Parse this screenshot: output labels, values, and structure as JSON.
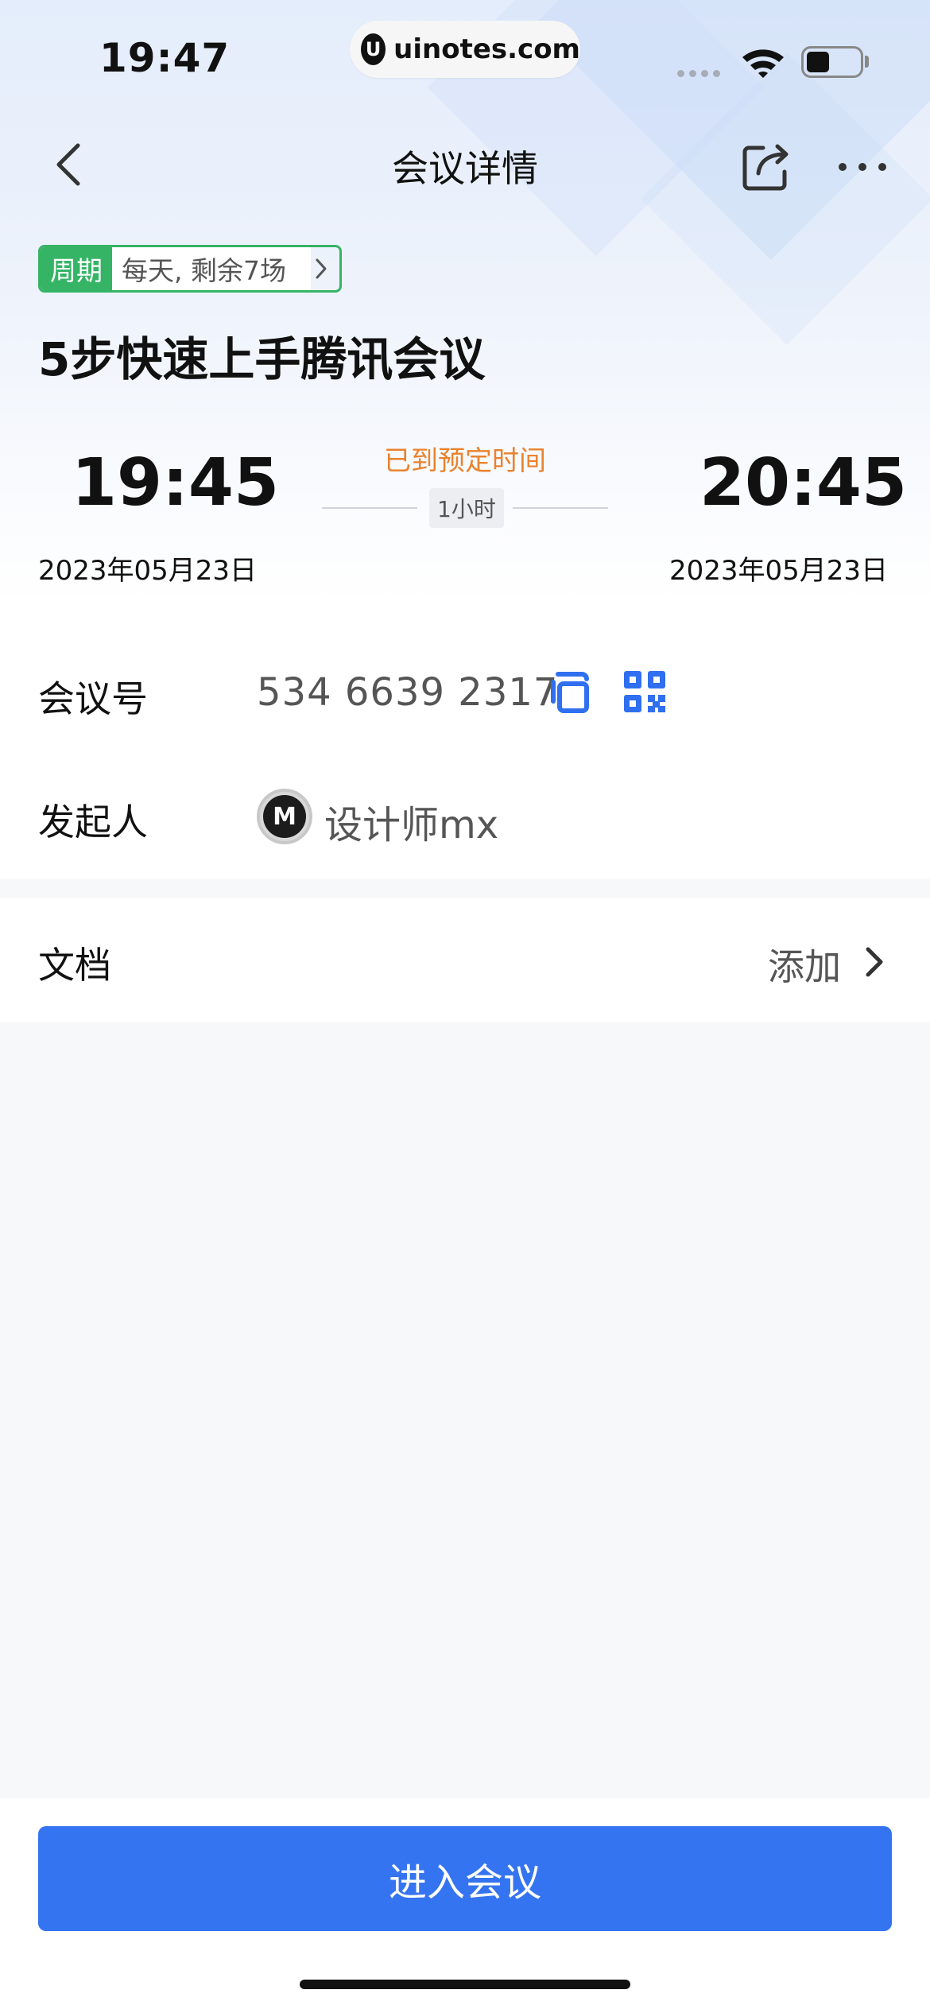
{
  "status_bar": {
    "time": "19:47",
    "url_logo": "U",
    "url": "uinotes.com",
    "icons": [
      "signal-icon",
      "wifi-icon",
      "battery-icon"
    ]
  },
  "nav": {
    "title": "会议详情",
    "icons": [
      "back-icon",
      "share-icon",
      "more-icon"
    ]
  },
  "meeting": {
    "tag_label": "周期",
    "tag_text": "每天, 剩余7场",
    "title": "5步快速上手腾讯会议",
    "start_time": "19:45",
    "end_time": "20:45",
    "start_date": "2023年05月23日",
    "end_date": "2023年05月23日",
    "status": "已到预定时间",
    "duration": "1小时"
  },
  "info": {
    "meeting_id_label": "会议号",
    "meeting_id": "534 6639 2317",
    "host_label": "发起人",
    "host_avatar_text": "M",
    "host_name": "设计师mx"
  },
  "docs": {
    "label": "文档",
    "add_label": "添加"
  },
  "footer": {
    "enter_button": "进入会议"
  },
  "colors": {
    "accent": "#3574f0",
    "tag_green": "#35b466",
    "status_orange": "#e9822e"
  }
}
